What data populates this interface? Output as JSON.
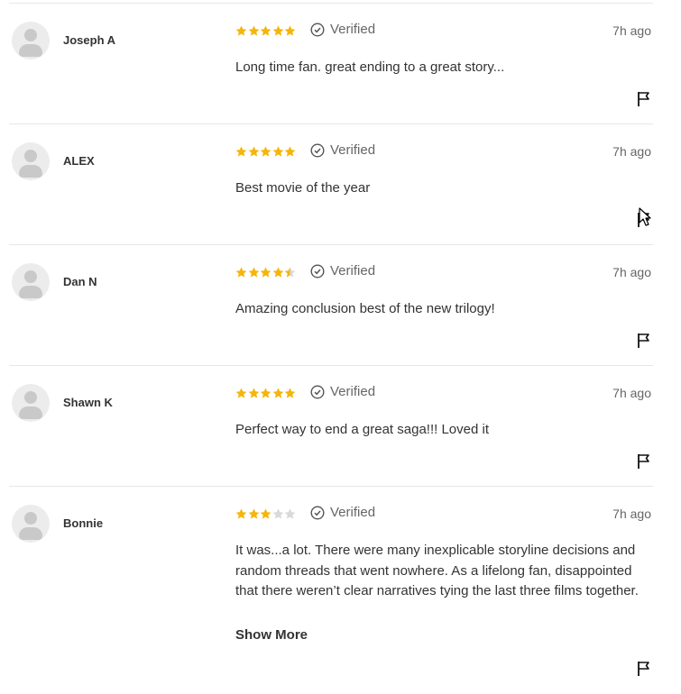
{
  "colors": {
    "star_filled": "#f5b50a",
    "star_empty": "#d9d9d9",
    "divider": "#e7e7e7"
  },
  "reviews": [
    {
      "name": "Joseph A",
      "rating": 5,
      "verified": "Verified",
      "time": "7h ago",
      "text": "Long time fan. great ending to a great story..."
    },
    {
      "name": "ALEX",
      "rating": 5,
      "verified": "Verified",
      "time": "7h ago",
      "text": "Best movie of the year"
    },
    {
      "name": "Dan N",
      "rating": 4.5,
      "verified": "Verified",
      "time": "7h ago",
      "text": "Amazing conclusion best of the new trilogy!"
    },
    {
      "name": "Shawn K",
      "rating": 5,
      "verified": "Verified",
      "time": "7h ago",
      "text": "Perfect way to end a great saga!!! Loved it"
    },
    {
      "name": "Bonnie",
      "rating": 3,
      "verified": "Verified",
      "time": "7h ago",
      "text": "It was...a lot. There were many inexplicable storyline decisions and random threads that went nowhere. As a lifelong fan, disappointed that there weren’t clear narratives tying the last three films together.",
      "show_more": "Show More"
    }
  ],
  "icons": {
    "avatar": "user-avatar-icon",
    "verified": "check-circle-icon",
    "flag": "flag-icon",
    "star": "star-icon"
  }
}
